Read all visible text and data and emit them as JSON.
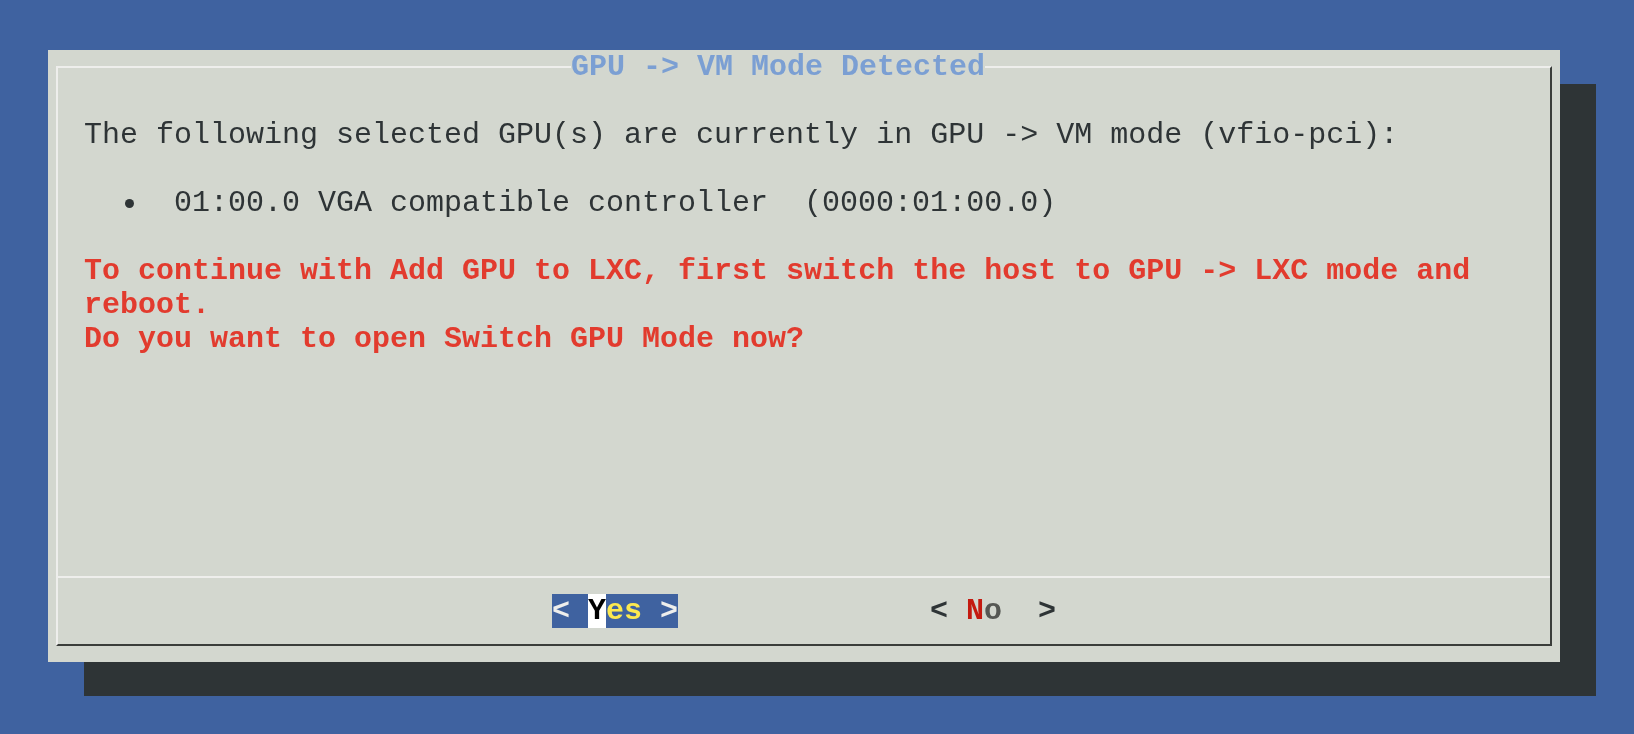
{
  "dialog": {
    "title": "GPU -> VM Mode Detected",
    "intro": "The following selected GPU(s) are currently in GPU -> VM mode (vfio-pci):",
    "devices": [
      {
        "text": "01:00.0 VGA compatible controller  (0000:01:00.0)"
      }
    ],
    "warning": [
      "To continue with Add GPU to LXC, first switch the host to GPU -> LXC mode and reboot.",
      "Do you want to open Switch GPU Mode now?"
    ],
    "buttons": [
      {
        "left": "<",
        "label": "Yes",
        "right": ">",
        "selected": true
      },
      {
        "left": "<",
        "label": "No",
        "right": ">",
        "selected": false
      }
    ]
  }
}
